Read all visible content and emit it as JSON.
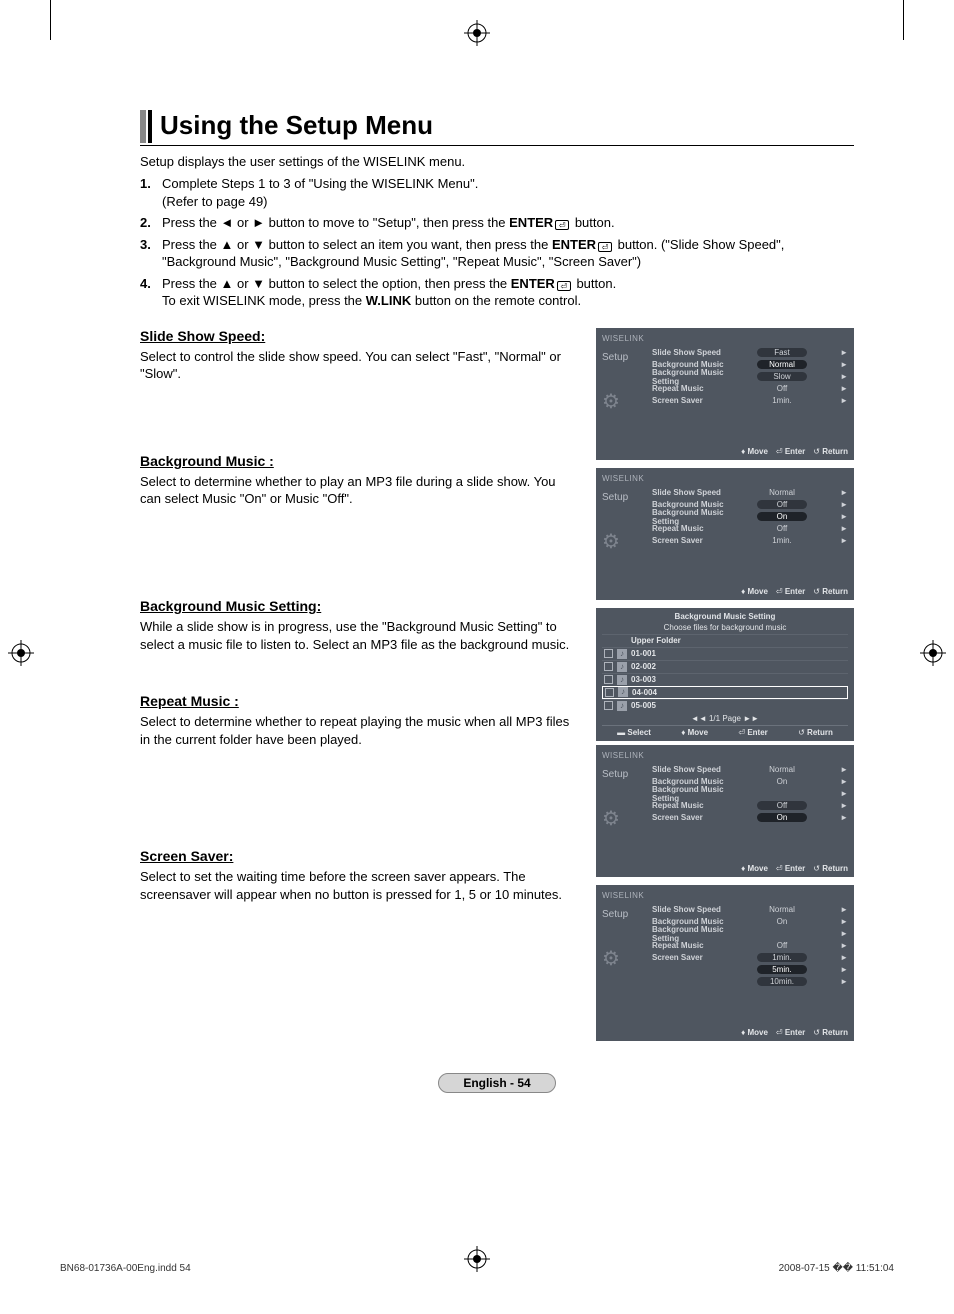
{
  "title": "Using the Setup Menu",
  "intro": "Setup displays the user settings of the WISELINK menu.",
  "steps": [
    {
      "num": "1.",
      "text": "Complete Steps 1 to 3 of \"Using the WISELINK Menu\".\n(Refer to page 49)"
    },
    {
      "num": "2.",
      "text": "Press the ◄ or ► button to move to \"Setup\", then press the ENTER⏎ button."
    },
    {
      "num": "3.",
      "text": "Press the ▲ or ▼ button to select an item you want, then press the ENTER⏎ button. (\"Slide Show Speed\", \"Background Music\", \"Background Music Setting\", \"Repeat Music\", \"Screen Saver\")"
    },
    {
      "num": "4.",
      "text": "Press the ▲ or ▼ button to select the option, then press the ENTER⏎ button.\nTo exit WISELINK mode, press the W.LINK button on the remote control."
    }
  ],
  "sections": {
    "slide": {
      "head": "Slide Show Speed:",
      "body": "Select to control the slide show speed. You can select \"Fast\", \"Normal\" or \"Slow\"."
    },
    "bgm": {
      "head": "Background Music :",
      "body": "Select to determine whether to play an MP3 file during a slide show. You can select Music \"On\" or Music \"Off\"."
    },
    "bgms": {
      "head": "Background Music Setting:",
      "body": "While a slide show is in progress, use the \"Background Music Setting\" to select a music file to listen to. Select an MP3 file as the background music."
    },
    "repeat": {
      "head": "Repeat Music :",
      "body": "Select to determine whether to repeat playing the music when all MP3 files in the current folder have been played."
    },
    "saver": {
      "head": "Screen Saver:",
      "body": "Select to set the waiting time before the screen saver appears. The screensaver will appear when no button is pressed for 1, 5 or 10 minutes."
    }
  },
  "osd_common": {
    "brand": "WISELINK",
    "side_label": "Setup",
    "footer_move": "Move",
    "footer_enter": "Enter",
    "footer_return": "Return",
    "footer_select": "Select"
  },
  "osd1_rows": [
    {
      "k": "Slide Show Speed",
      "v": "Fast",
      "pill": true
    },
    {
      "k": "Background Music",
      "v": "Normal",
      "pill": true,
      "sel": true
    },
    {
      "k": "Background Music Setting",
      "v": "Slow",
      "pill": true
    },
    {
      "k": "Repeat Music",
      "v": "Off"
    },
    {
      "k": "Screen Saver",
      "v": "1min."
    }
  ],
  "osd2_rows": [
    {
      "k": "Slide Show Speed",
      "v": "Normal"
    },
    {
      "k": "Background Music",
      "v": "Off",
      "pill": true
    },
    {
      "k": "Background Music Setting",
      "v": "On",
      "pill": true,
      "sel": true
    },
    {
      "k": "Repeat Music",
      "v": "Off"
    },
    {
      "k": "Screen Saver",
      "v": "1min."
    }
  ],
  "osd3": {
    "title": "Background Music Setting",
    "sub": "Choose files for background music",
    "rows": [
      "Upper Folder",
      "01-001",
      "02-002",
      "03-003",
      "04-004",
      "05-005"
    ],
    "sel_idx": 4,
    "pager": "◄◄ 1/1 Page ►►"
  },
  "osd4_rows": [
    {
      "k": "Slide Show Speed",
      "v": "Normal"
    },
    {
      "k": "Background Music",
      "v": "On"
    },
    {
      "k": "Background Music Setting",
      "v": ""
    },
    {
      "k": "Repeat Music",
      "v": "Off",
      "pill": true
    },
    {
      "k": "Screen Saver",
      "v": "On",
      "pill": true,
      "sel": true
    }
  ],
  "osd5_rows": [
    {
      "k": "Slide Show Speed",
      "v": "Normal"
    },
    {
      "k": "Background Music",
      "v": "On"
    },
    {
      "k": "Background Music Setting",
      "v": ""
    },
    {
      "k": "Repeat Music",
      "v": "Off"
    },
    {
      "k": "Screen Saver",
      "v": "1min.",
      "pill": true
    },
    {
      "k": "",
      "v": "5min.",
      "pill": true,
      "sel": true
    },
    {
      "k": "",
      "v": "10min.",
      "pill": true
    }
  ],
  "page_foot": "English - 54",
  "imprint_left": "BN68-01736A-00Eng.indd   54",
  "imprint_right": "2008-07-15   �� 11:51:04"
}
